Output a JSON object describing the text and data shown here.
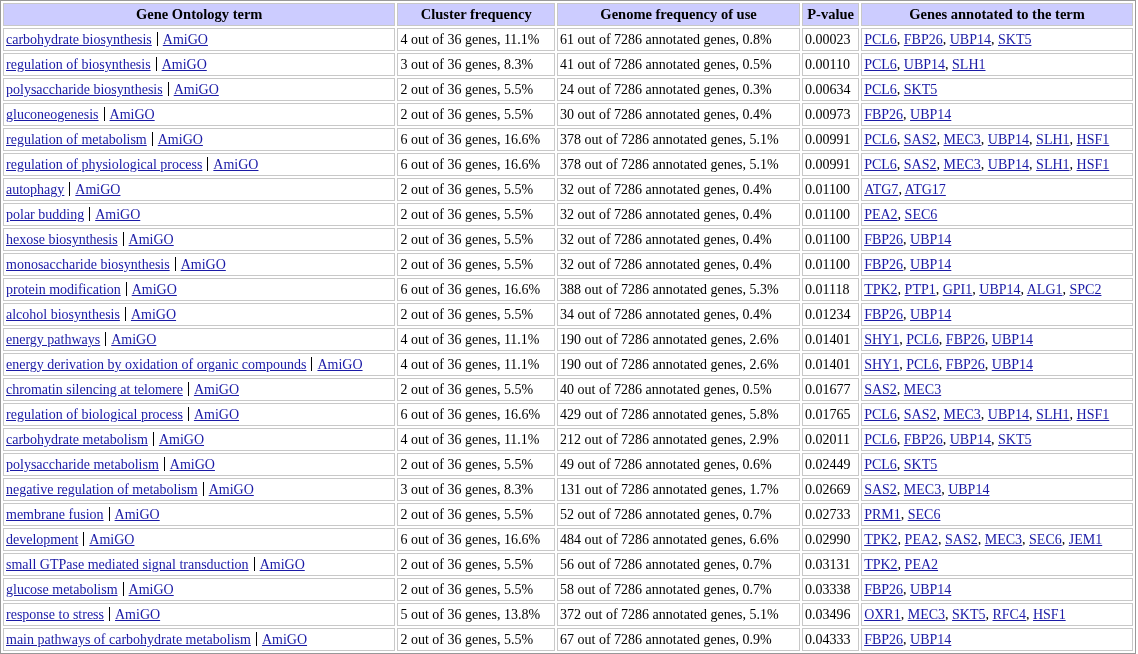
{
  "table": {
    "columns": [
      "Gene Ontology term",
      "Cluster frequency",
      "Genome frequency of use",
      "P-value",
      "Genes annotated to the term"
    ],
    "rows": [
      {
        "term": "carbohydrate biosynthesis",
        "link": "AmiGO",
        "cluster": "4 out of 36 genes, 11.1%",
        "genome": "61 out of 7286 annotated genes, 0.8%",
        "p_value": "0.00023",
        "genes": [
          {
            "symbol": "PCL6",
            "punct": ","
          },
          {
            "symbol": "FBP26",
            "punct": ","
          },
          {
            "symbol": "UBP14",
            "punct": ","
          },
          {
            "symbol": "SKT5"
          }
        ]
      },
      {
        "term": "regulation of biosynthesis",
        "link": "AmiGO",
        "cluster": "3 out of 36 genes, 8.3%",
        "genome": "41 out of 7286 annotated genes, 0.5%",
        "p_value": "0.00110",
        "genes": [
          {
            "symbol": "PCL6",
            "punct": ","
          },
          {
            "symbol": "UBP14",
            "punct": ","
          },
          {
            "symbol": "SLH1"
          }
        ]
      },
      {
        "term": "polysaccharide biosynthesis",
        "link": "AmiGO",
        "cluster": "2 out of 36 genes, 5.5%",
        "genome": "24 out of 7286 annotated genes, 0.3%",
        "p_value": "0.00634",
        "genes": [
          {
            "symbol": "PCL6",
            "punct": ","
          },
          {
            "symbol": "SKT5"
          }
        ]
      },
      {
        "term": "gluconeogenesis",
        "link": "AmiGO",
        "cluster": "2 out of 36 genes, 5.5%",
        "genome": "30 out of 7286 annotated genes, 0.4%",
        "p_value": "0.00973",
        "genes": [
          {
            "symbol": "FBP26",
            "punct": ","
          },
          {
            "symbol": "UBP14"
          }
        ]
      },
      {
        "term": "regulation of metabolism",
        "link": "AmiGO",
        "cluster": "6 out of 36 genes, 16.6%",
        "genome": "378 out of 7286 annotated genes, 5.1%",
        "p_value": "0.00991",
        "genes": [
          {
            "symbol": "PCL6",
            "punct": ","
          },
          {
            "symbol": "SAS2",
            "punct": ","
          },
          {
            "symbol": "MEC3",
            "punct": ","
          },
          {
            "symbol": "UBP14",
            "punct": ","
          },
          {
            "symbol": "SLH1",
            "punct": ","
          },
          {
            "symbol": "HSF1"
          }
        ]
      },
      {
        "term": "regulation of physiological process",
        "link": "AmiGO",
        "cluster": "6 out of 36 genes, 16.6%",
        "genome": "378 out of 7286 annotated genes, 5.1%",
        "p_value": "0.00991",
        "genes": [
          {
            "symbol": "PCL6",
            "punct": ","
          },
          {
            "symbol": "SAS2",
            "punct": ","
          },
          {
            "symbol": "MEC3",
            "punct": ","
          },
          {
            "symbol": "UBP14",
            "punct": ","
          },
          {
            "symbol": "SLH1",
            "punct": ","
          },
          {
            "symbol": "HSF1"
          }
        ]
      },
      {
        "term": "autophagy",
        "link": "AmiGO",
        "cluster": "2 out of 36 genes, 5.5%",
        "genome": "32 out of 7286 annotated genes, 0.4%",
        "p_value": "0.01100",
        "genes": [
          {
            "symbol": "ATG7",
            "punct": ","
          },
          {
            "symbol": "ATG17"
          }
        ]
      },
      {
        "term": "polar budding",
        "link": "AmiGO",
        "cluster": "2 out of 36 genes, 5.5%",
        "genome": "32 out of 7286 annotated genes, 0.4%",
        "p_value": "0.01100",
        "genes": [
          {
            "symbol": "PEA2",
            "punct": ","
          },
          {
            "symbol": "SEC6"
          }
        ]
      },
      {
        "term": "hexose biosynthesis",
        "link": "AmiGO",
        "cluster": "2 out of 36 genes, 5.5%",
        "genome": "32 out of 7286 annotated genes, 0.4%",
        "p_value": "0.01100",
        "genes": [
          {
            "symbol": "FBP26",
            "punct": ","
          },
          {
            "symbol": "UBP14"
          }
        ]
      },
      {
        "term": "monosaccharide biosynthesis",
        "link": "AmiGO",
        "cluster": "2 out of 36 genes, 5.5%",
        "genome": "32 out of 7286 annotated genes, 0.4%",
        "p_value": "0.01100",
        "genes": [
          {
            "symbol": "FBP26",
            "punct": ","
          },
          {
            "symbol": "UBP14"
          }
        ]
      },
      {
        "term": "protein modification",
        "link": "AmiGO",
        "cluster": "6 out of 36 genes, 16.6%",
        "genome": "388 out of 7286 annotated genes, 5.3%",
        "p_value": "0.01118",
        "genes": [
          {
            "symbol": "TPK2",
            "punct": ","
          },
          {
            "symbol": "PTP1",
            "punct": ","
          },
          {
            "symbol": "GPI1",
            "punct": ","
          },
          {
            "symbol": "UBP14",
            "punct": ","
          },
          {
            "symbol": "ALG1",
            "punct": ","
          },
          {
            "symbol": "SPC2"
          }
        ]
      },
      {
        "term": "alcohol biosynthesis",
        "link": "AmiGO",
        "cluster": "2 out of 36 genes, 5.5%",
        "genome": "34 out of 7286 annotated genes, 0.4%",
        "p_value": "0.01234",
        "genes": [
          {
            "symbol": "FBP26",
            "punct": ","
          },
          {
            "symbol": "UBP14"
          }
        ]
      },
      {
        "term": "energy pathways",
        "link": "AmiGO",
        "cluster": "4 out of 36 genes, 11.1%",
        "genome": "190 out of 7286 annotated genes, 2.6%",
        "p_value": "0.01401",
        "genes": [
          {
            "symbol": "SHY1",
            "punct": ","
          },
          {
            "symbol": "PCL6",
            "punct": ","
          },
          {
            "symbol": "FBP26",
            "punct": ","
          },
          {
            "symbol": "UBP14"
          }
        ]
      },
      {
        "term": "energy derivation by oxidation of organic compounds",
        "link": "AmiGO",
        "cluster": "4 out of 36 genes, 11.1%",
        "genome": "190 out of 7286 annotated genes, 2.6%",
        "p_value": "0.01401",
        "genes": [
          {
            "symbol": "SHY1",
            "punct": ","
          },
          {
            "symbol": "PCL6",
            "punct": ","
          },
          {
            "symbol": "FBP26",
            "punct": ","
          },
          {
            "symbol": "UBP14"
          }
        ]
      },
      {
        "term": "chromatin silencing at telomere",
        "link": "AmiGO",
        "cluster": "2 out of 36 genes, 5.5%",
        "genome": "40 out of 7286 annotated genes, 0.5%",
        "p_value": "0.01677",
        "genes": [
          {
            "symbol": "SAS2",
            "punct": ","
          },
          {
            "symbol": "MEC3"
          }
        ]
      },
      {
        "term": "regulation of biological process",
        "link": "AmiGO",
        "cluster": "6 out of 36 genes, 16.6%",
        "genome": "429 out of 7286 annotated genes, 5.8%",
        "p_value": "0.01765",
        "genes": [
          {
            "symbol": "PCL6",
            "punct": ","
          },
          {
            "symbol": "SAS2",
            "punct": ","
          },
          {
            "symbol": "MEC3",
            "punct": ","
          },
          {
            "symbol": "UBP14",
            "punct": ","
          },
          {
            "symbol": "SLH1",
            "punct": ","
          },
          {
            "symbol": "HSF1"
          }
        ]
      },
      {
        "term": "carbohydrate metabolism",
        "link": "AmiGO",
        "cluster": "4 out of 36 genes, 11.1%",
        "genome": "212 out of 7286 annotated genes, 2.9%",
        "p_value": "0.02011",
        "genes": [
          {
            "symbol": "PCL6",
            "punct": ","
          },
          {
            "symbol": "FBP26",
            "punct": ","
          },
          {
            "symbol": "UBP14",
            "punct": ","
          },
          {
            "symbol": "SKT5"
          }
        ]
      },
      {
        "term": "polysaccharide metabolism",
        "link": "AmiGO",
        "cluster": "2 out of 36 genes, 5.5%",
        "genome": "49 out of 7286 annotated genes, 0.6%",
        "p_value": "0.02449",
        "genes": [
          {
            "symbol": "PCL6",
            "punct": ","
          },
          {
            "symbol": "SKT5"
          }
        ]
      },
      {
        "term": "negative regulation of metabolism",
        "link": "AmiGO",
        "cluster": "3 out of 36 genes, 8.3%",
        "genome": "131 out of 7286 annotated genes, 1.7%",
        "p_value": "0.02669",
        "genes": [
          {
            "symbol": "SAS2",
            "punct": ","
          },
          {
            "symbol": "MEC3",
            "punct": ","
          },
          {
            "symbol": "UBP14"
          }
        ]
      },
      {
        "term": "membrane fusion",
        "link": "AmiGO",
        "cluster": "2 out of 36 genes, 5.5%",
        "genome": "52 out of 7286 annotated genes, 0.7%",
        "p_value": "0.02733",
        "genes": [
          {
            "symbol": "PRM1",
            "punct": ","
          },
          {
            "symbol": "SEC6"
          }
        ]
      },
      {
        "term": "development",
        "link": "AmiGO",
        "cluster": "6 out of 36 genes, 16.6%",
        "genome": "484 out of 7286 annotated genes, 6.6%",
        "p_value": "0.02990",
        "genes": [
          {
            "symbol": "TPK2",
            "punct": ","
          },
          {
            "symbol": "PEA2",
            "punct": ","
          },
          {
            "symbol": "SAS2",
            "punct": ","
          },
          {
            "symbol": "MEC3",
            "punct": ","
          },
          {
            "symbol": "SEC6",
            "punct": ","
          },
          {
            "symbol": "JEM1"
          }
        ]
      },
      {
        "term": "small GTPase mediated signal transduction",
        "link": "AmiGO",
        "cluster": "2 out of 36 genes, 5.5%",
        "genome": "56 out of 7286 annotated genes, 0.7%",
        "p_value": "0.03131",
        "genes": [
          {
            "symbol": "TPK2",
            "punct": ","
          },
          {
            "symbol": "PEA2"
          }
        ]
      },
      {
        "term": "glucose metabolism",
        "link": "AmiGO",
        "cluster": "2 out of 36 genes, 5.5%",
        "genome": "58 out of 7286 annotated genes, 0.7%",
        "p_value": "0.03338",
        "genes": [
          {
            "symbol": "FBP26",
            "punct": ","
          },
          {
            "symbol": "UBP14"
          }
        ]
      },
      {
        "term": "response to stress",
        "link": "AmiGO",
        "cluster": "5 out of 36 genes, 13.8%",
        "genome": "372 out of 7286 annotated genes, 5.1%",
        "p_value": "0.03496",
        "genes": [
          {
            "symbol": "OXR1",
            "punct": ","
          },
          {
            "symbol": "MEC3",
            "punct": ","
          },
          {
            "symbol": "SKT5",
            "punct": ","
          },
          {
            "symbol": "RFC4",
            "punct": ","
          },
          {
            "symbol": "HSF1"
          }
        ]
      },
      {
        "term": "main pathways of carbohydrate metabolism",
        "link": "AmiGO",
        "cluster": "2 out of 36 genes, 5.5%",
        "genome": "67 out of 7286 annotated genes, 0.9%",
        "p_value": "0.04333",
        "genes": [
          {
            "symbol": "FBP26",
            "punct": ","
          },
          {
            "symbol": "UBP14"
          }
        ]
      }
    ]
  }
}
